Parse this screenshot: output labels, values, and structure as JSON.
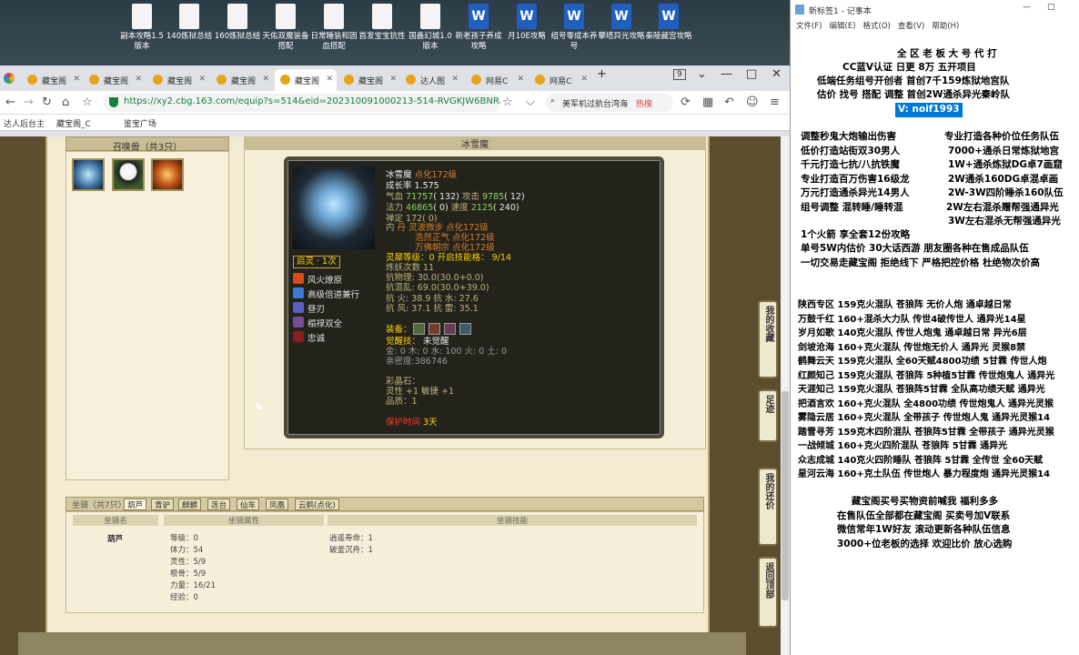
{
  "desktop": {
    "icons": [
      {
        "label": "副本攻略1.5版本",
        "type": "doc"
      },
      {
        "label": "140炼狱总结",
        "type": "doc"
      },
      {
        "label": "160炼狱总结",
        "type": "doc"
      },
      {
        "label": "天佑双魔装备搭配",
        "type": "doc"
      },
      {
        "label": "日常睡装和固血搭配",
        "type": "doc"
      },
      {
        "label": "首发宝宝抗性",
        "type": "doc"
      },
      {
        "label": "国鑫幻城1.0版本",
        "type": "doc"
      },
      {
        "label": "新老孩子养成攻略",
        "type": "word"
      },
      {
        "label": "月10E攻略",
        "type": "word"
      },
      {
        "label": "组号零成本养号",
        "type": "word"
      },
      {
        "label": "攀塔异光攻略",
        "type": "word"
      },
      {
        "label": "秦陵藏宫攻略",
        "type": "word"
      }
    ]
  },
  "browser": {
    "tabs": [
      "藏宝阁",
      "藏宝阁",
      "藏宝阁",
      "藏宝阁",
      "藏宝阁",
      "藏宝阁",
      "达人图",
      "网易C",
      "网易C"
    ],
    "tab_count": "9",
    "url": "https://xy2.cbg.163.com/equip?s=514&eid=202310091000213-514-RVGKJW6BNRLE&o&",
    "search_text": "美军机过航台湾海",
    "hot_label": "热搜",
    "bookmarks": [
      "达人后台主",
      "藏宝阁_C",
      "鉴宝广场"
    ]
  },
  "summon": {
    "title": "召唤兽（共3只）"
  },
  "detail": {
    "title": "冰雪魔",
    "name": "冰雪魔",
    "name_suffix": "点化172级",
    "growth": "成长率 1.575",
    "hp_label": "气血",
    "hp": "71757",
    "hp_base": "( 132)",
    "atk_label": "攻击",
    "atk": "9785",
    "atk_base": "( 12)",
    "mp_label": "法力",
    "mp": "46865",
    "mp_base": "( 0)",
    "spd_label": "速度",
    "spd": "2125",
    "spd_base": "( 240)",
    "zen": "禅定 172( 0)",
    "inner_label": "内",
    "inner_1": "丹 灵波微步 点化172级",
    "inner_2": "浩然正气 点化172级",
    "inner_3": "万佛朝宗 点化172级",
    "enlight": "启灵 · 1次",
    "lingxi": "灵犀等级：",
    "lingxi_val": "0 开启技能格：",
    "lingxi_slots": "9/14",
    "demon": "炼妖次数 11",
    "anti_poison": "抗物理: 30.0(30.0+0.0)",
    "anti_chaos": "抗混乱: 69.0(30.0+39.0)",
    "resist_1": "抗  火: 38.9 抗  水: 27.6",
    "resist_2": "抗  风: 37.1 抗  雷: 35.1",
    "skills": [
      "风火燎原",
      "高级倍道兼行",
      "昼刃",
      "榻禄双全",
      "忠诚"
    ],
    "equip_label": "装备：",
    "awaken_label": "觉醒技：",
    "awaken_val": "未觉醒",
    "elements": "金: 0 木: 0 水: 100 火: 0 土: 0",
    "intimacy": "亲密度:386746",
    "gem_label": "彩晶石：",
    "gem_1": "灵性 +1 敏捷 +1",
    "gem_2": "品质：1",
    "protect_label": "保护时间",
    "protect_val": "3天"
  },
  "mount": {
    "title": "坐骑（共7只）",
    "tabs": [
      "葫芦",
      "青驴",
      "麒麟",
      "莲台",
      "仙车",
      "凤凰",
      "云鹤(点化)"
    ],
    "col_name": "坐骑名",
    "col_attr": "坐骑属性",
    "col_skill": "坐骑技能",
    "name": "葫芦",
    "attrs": [
      "等级：0",
      "体力：54",
      "灵性：5/9",
      "根骨：5/9",
      "力量：16/21",
      "经验：0"
    ],
    "skills": [
      "逍遥寿命：1",
      "破釜沉舟：1"
    ]
  },
  "sidebar": {
    "fav": "我的收藏",
    "footprint": "足迹",
    "bargain": "我的还价",
    "top": "返回顶部"
  },
  "notepad": {
    "title": "新标签1 - 记事本",
    "menu": [
      "文件(F)",
      "编辑(E)",
      "格式(O)",
      "查看(V)",
      "帮助(H)"
    ],
    "lines_top": [
      "全  区  老 板  大  号  代  打",
      "CC蓝V认证 日更   8万  五开项目",
      "低端任务组号开创者          首创7千159炼狱地宫队",
      "估价 找号 搭配 调整          首创2W通杀异光秦岭队"
    ],
    "vx": "V:  noif1993",
    "services_left": [
      "调整秒鬼大炮输出伤害",
      "低价打造站街双30男人",
      "千元打造七抗/八抗铁魔",
      "专业打造百万伤害16级龙",
      "万元打造通杀异光14男人",
      "组号调整 混转睡/睡转混"
    ],
    "services_right": [
      "专业打造各种价位任务队伍",
      "7000+通杀日常炼狱地宫",
      "1W+通杀炼狱DG卓7画窟",
      "2W通杀160DG卓混卓画",
      "2W-3W四阶睡杀160队伍",
      "2W左右混杀赠帮强通异光",
      "3W左右混杀无帮强通异光"
    ],
    "line_a": "1个火箭 享全套12份攻略",
    "line_b": "单号5W内估价 30大话西游           朋友圈各种在售成品队伍",
    "line_c": "一切交易走藏宝阁 拒绝线下     严格把控价格 杜绝物次价高",
    "teams": [
      "陕西专区 159克火混队 苍狼阵 无价人炮 通卓越日常",
      "万鼓千红 160+混杀大力队 传世4破传世人 通异光14星",
      "岁月如歌 140克火混队 传世人炮鬼 通卓越日常 异光6层",
      "剑坡沧海 160+克火混队 传世炮无价人 通异光 灵猴8禁",
      "鹤舞云天 159克火混队 全60天赋4800功绩 5甘霖 传世人炮",
      "红颜知己 159克火混队 苍狼阵 5种植5甘霖 传世炮鬼人 通异光",
      "天涯知己 159克火混队 苍狼阵5甘霖 全队高功绩天赋 通异光",
      "把酒言欢 160+克火混队 全4800功绩 传世炮鬼人 通异光灵猴",
      "雾隐云居 160+克火混队 全带孩子 传世炮人鬼 通异光灵猴14",
      "踏雪寻芳 159克木四阶混队 苍狼阵5甘霖 全带孩子 通异光灵猴",
      "一战倾城 160+克火四阶混队 苍狼阵 5甘霖 通异光",
      "众志成城 140克火四阶睡队 苍狼阵 5甘霖 全传世 全60天赋",
      "星河云海 160+克土队伍 传世炮人 暴力程度炮 通异光灵猴14"
    ],
    "footer": [
      "藏宝阁买号买物资前喊我 福利多多",
      "在售队伍全部都在藏宝阁 买卖号加V联系",
      "微信常年1W好友 滚动更新各种队伍信息",
      "3000+位老板的选择 欢迎比价 放心选购"
    ]
  }
}
